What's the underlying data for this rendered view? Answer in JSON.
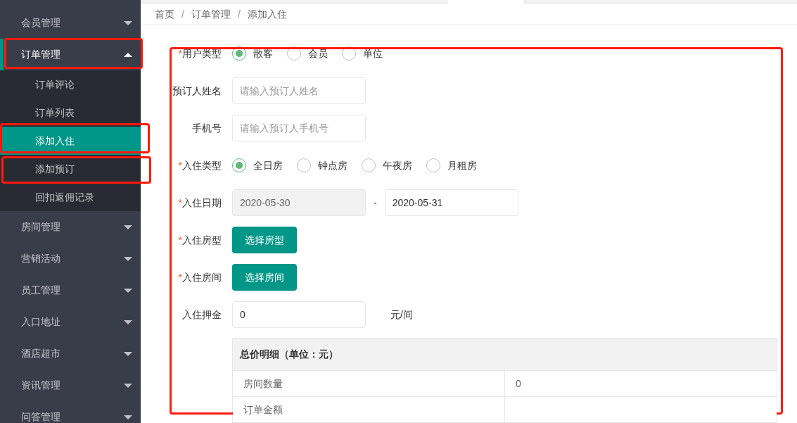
{
  "sidebar": {
    "items": [
      {
        "label": "会员管理",
        "expanded": false
      },
      {
        "label": "订单管理",
        "expanded": true,
        "children": [
          {
            "label": "订单评论",
            "selected": false
          },
          {
            "label": "订单列表",
            "selected": false
          },
          {
            "label": "添加入住",
            "selected": true
          },
          {
            "label": "添加预订",
            "selected": false
          },
          {
            "label": "回扣返佣记录",
            "selected": false
          }
        ]
      },
      {
        "label": "房间管理",
        "expanded": false
      },
      {
        "label": "营销活动",
        "expanded": false
      },
      {
        "label": "员工管理",
        "expanded": false
      },
      {
        "label": "入口地址",
        "expanded": false
      },
      {
        "label": "酒店超市",
        "expanded": false
      },
      {
        "label": "资讯管理",
        "expanded": false
      },
      {
        "label": "问答管理",
        "expanded": false
      }
    ]
  },
  "breadcrumb": [
    {
      "label": "首页"
    },
    {
      "separator": "/",
      "label": "订单管理"
    },
    {
      "separator": "/",
      "label": "添加入住"
    }
  ],
  "form": {
    "rows": [
      {
        "kind": "radio",
        "label": "用户类型",
        "required_mark": "*",
        "options": [
          {
            "label": "散客",
            "selected": true
          },
          {
            "label": "会员",
            "selected": false
          },
          {
            "label": "单位",
            "selected": false
          }
        ]
      },
      {
        "kind": "input",
        "label": "预订人姓名",
        "placeholder": "请输入预订人姓名"
      },
      {
        "kind": "input",
        "label": "手机号",
        "placeholder": "请输入预订人手机号"
      },
      {
        "kind": "radio",
        "label": "入住类型",
        "required_mark": "*",
        "options": [
          {
            "label": "全日房",
            "selected": true
          },
          {
            "label": "钟点房",
            "selected": false
          },
          {
            "label": "午夜房",
            "selected": false
          },
          {
            "label": "月租房",
            "selected": false
          }
        ]
      },
      {
        "kind": "daterange",
        "label": "入住日期",
        "required_mark": "*",
        "start": "2020-05-30",
        "start_disabled": true,
        "separator": "-",
        "end": "2020-05-31"
      },
      {
        "kind": "button",
        "label": "入住房型",
        "required_mark": "*",
        "button": "选择房型"
      },
      {
        "kind": "button",
        "label": "入住房间",
        "required_mark": "*",
        "button": "选择房间"
      },
      {
        "kind": "input",
        "label": "入住押金",
        "value": "0",
        "unit": "元/间"
      }
    ]
  },
  "price_table": {
    "title": "总价明细（单位：元）",
    "rows": [
      [
        "房间数量",
        "0"
      ],
      [
        "订单金额",
        ""
      ]
    ]
  }
}
